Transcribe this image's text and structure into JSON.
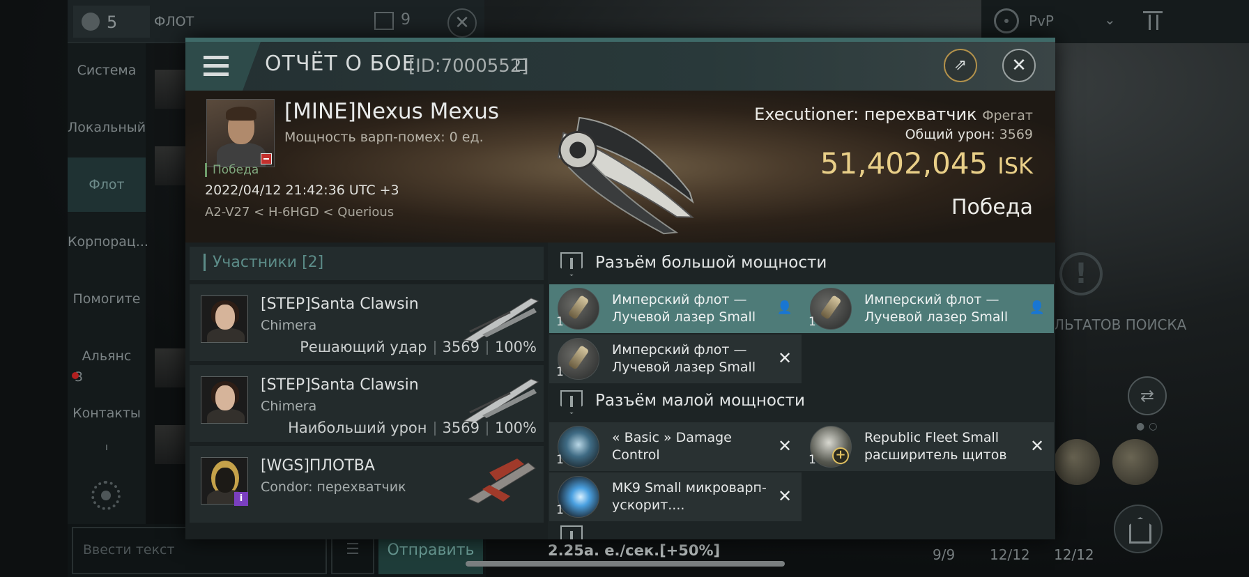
{
  "background": {
    "top_bar": {
      "members_count": "5",
      "fleet_label": "ФЛОТ",
      "count": "9"
    },
    "sidebar": {
      "items": [
        "Система",
        "Локальный",
        "Флот",
        "Корпорац...",
        "Помогите",
        "Альянс",
        "Контакты"
      ],
      "alliance_badge": "3",
      "divider": "ı"
    },
    "chat": {
      "placeholder": "Ввести текст",
      "send_label": "Отправить"
    },
    "speed": "2.25а. е./сек.[+50%]",
    "filter": {
      "label": "PvP"
    },
    "search_results": "ЛЬТАТОВ ПОИСКА",
    "slot_counts": [
      "9/9",
      "12/12",
      "12/12"
    ]
  },
  "modal": {
    "title": "ОТЧЁТ О БОЕ",
    "report_id": "[ID:7000552]",
    "victim": {
      "name": "[MINE]Nexus Mexus",
      "warp_disruption": "Мощность варп-помех: 0 ед.",
      "result_small": "Победа",
      "datetime": "2022/04/12 21:42:36 UTC +3",
      "route": "A2-V27 < H-6HGD < Querious"
    },
    "ship": {
      "name": "Executioner: перехватчик",
      "class": "Фрегат",
      "total_damage_label": "Общий урон:",
      "total_damage_value": "3569",
      "isk_value": "51,402,045",
      "isk_unit": "ISK",
      "result": "Победа"
    },
    "participants": {
      "label": "Участники",
      "count": "[2]",
      "rows": [
        {
          "name": "[STEP]Santa Clawsin",
          "ship": "Chimera",
          "role": "Решающий удар",
          "damage": "3569",
          "percent": "100%"
        },
        {
          "name": "[STEP]Santa Clawsin",
          "ship": "Chimera",
          "role": "Наибольший урон",
          "damage": "3569",
          "percent": "100%"
        },
        {
          "name": "[WGS]ПЛОТВА",
          "ship": "Condor: перехватчик",
          "badge": "i"
        }
      ]
    },
    "high_slots": {
      "title": "Разъём большой мощности",
      "modules": [
        {
          "qty": "1",
          "name": "Имперский флот — Лучевой лазер Small",
          "status": "dropped"
        },
        {
          "qty": "1",
          "name": "Имперский флот — Лучевой лазер Small",
          "status": "dropped"
        },
        {
          "qty": "1",
          "name": "Имперский флот — Лучевой лазер Small",
          "status": "destroyed"
        }
      ]
    },
    "low_slots": {
      "title": "Разъём малой мощности",
      "modules": [
        {
          "qty": "1",
          "name": "« Basic » Damage Control",
          "status": "destroyed"
        },
        {
          "qty": "1",
          "name": "Republic Fleet Small расширитель щитов",
          "status": "destroyed"
        },
        {
          "qty": "1",
          "name": "MK9 Small микроварп-ускорит....",
          "status": "destroyed"
        }
      ]
    },
    "icons": {
      "close": "✕",
      "status_destroyed": "✕",
      "status_dropped": "👤"
    },
    "colors": {
      "accent": "#4e7b78",
      "isk": "#e9cf88",
      "victory": "#7fa77e"
    }
  }
}
